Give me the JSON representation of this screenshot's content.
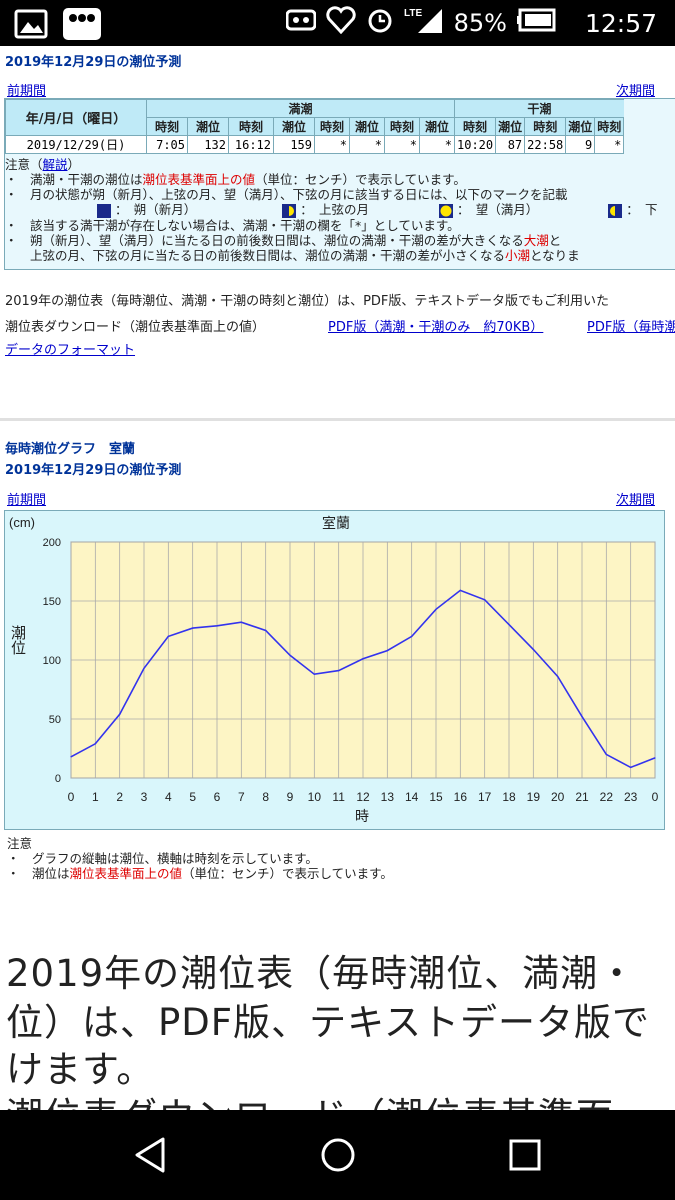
{
  "status_bar": {
    "battery": "85%",
    "time": "12:57",
    "network": "LTE",
    "app_badge": "ラクマ"
  },
  "section1": {
    "title": "2019年12月29日の潮位予測",
    "prev": "前期間",
    "next": "次期間",
    "table": {
      "col_date": "年/月/日（曜日）",
      "high_label": "満潮",
      "low_label": "干潮",
      "high_sub": [
        "時刻",
        "潮位",
        "時刻",
        "潮位",
        "時刻",
        "潮位",
        "時刻",
        "潮位"
      ],
      "low_sub": [
        "時刻",
        "潮位",
        "時刻",
        "潮位",
        "時刻"
      ],
      "row": {
        "date": "2019/12/29(日)",
        "high": [
          "7:05",
          "132",
          "16:12",
          "159",
          "*",
          "*",
          "*",
          "*"
        ],
        "low": [
          "10:20",
          "87",
          "22:58",
          "9",
          "*"
        ]
      }
    },
    "notes": {
      "label": "注意（",
      "explain_link": "解説",
      "label_end": "）",
      "line1_a": "・　満潮・干潮の潮位は",
      "line1_red": "潮位表基準面上の値",
      "line1_b": "（単位：センチ）で表示しています。",
      "line2": "・　月の状態が朔（新月）、上弦の月、望（満月）、下弦の月に該当する日には、以下のマークを記載",
      "moons": [
        "：　朔（新月）",
        "：　上弦の月",
        "：　望（満月）",
        "：　下"
      ],
      "line4": "・　該当する満干潮が存在しない場合は、満潮・干潮の欄を「*」としています。",
      "line5_a": "・　朔（新月）、望（満月）に当たる日の前後数日間は、潮位の満潮・干潮の差が大きくなる",
      "line5_red": "大潮",
      "line5_b": "と",
      "line6_a": "　　上弦の月、下弦の月に当たる日の前後数日間は、潮位の満潮・干潮の差が小さくなる",
      "line6_red": "小潮",
      "line6_b": "となりま"
    },
    "para": "2019年の潮位表（毎時潮位、満潮・干潮の時刻と潮位）は、PDF版、テキストデータ版でもご利用いた",
    "download_label": "潮位表ダウンロード（潮位表基準面上の値）",
    "pdf_link1": "PDF版（満潮・干潮のみ　約70KB）",
    "pdf_link2": "PDF版（毎時潮",
    "format_link": "データのフォーマット"
  },
  "section2": {
    "title": "毎時潮位グラフ　室蘭",
    "subtitle": "2019年12月29日の潮位予測",
    "prev": "前期間",
    "next": "次期間",
    "notes_label": "注意",
    "note1": "・　グラフの縦軸は潮位、横軸は時刻を示しています。",
    "note2_a": "・　潮位は",
    "note2_red": "潮位表基準面上の値",
    "note2_b": "（単位：センチ）で表示しています。"
  },
  "chart_data": {
    "type": "line",
    "title": "室蘭",
    "unit_label": "(cm)",
    "ylabel": "潮位",
    "xlabel": "時",
    "x": [
      "0",
      "1",
      "2",
      "3",
      "4",
      "5",
      "6",
      "7",
      "8",
      "9",
      "10",
      "11",
      "12",
      "13",
      "14",
      "15",
      "16",
      "17",
      "18",
      "19",
      "20",
      "21",
      "22",
      "23",
      "0"
    ],
    "values": [
      18,
      29,
      54,
      93,
      120,
      127,
      129,
      132,
      125,
      104,
      88,
      91,
      101,
      108,
      120,
      143,
      159,
      151,
      130,
      109,
      86,
      52,
      20,
      9,
      17
    ],
    "ylim": [
      0,
      200
    ],
    "yticks": [
      "0",
      "50",
      "100",
      "150",
      "200"
    ],
    "grid": true,
    "colors": {
      "line": "#3333ee",
      "plot_bg": "#fdf5c5",
      "grid": "#aaaaaa",
      "box_bg": "#d9f6fb"
    }
  },
  "bottom_text": {
    "line1": "2019年の潮位表（毎時潮位、満潮・",
    "line2": "位）は、PDF版、テキストデータ版で",
    "line3": "けます。",
    "line4": "潮位表ダウンロード（潮位表基準面"
  }
}
